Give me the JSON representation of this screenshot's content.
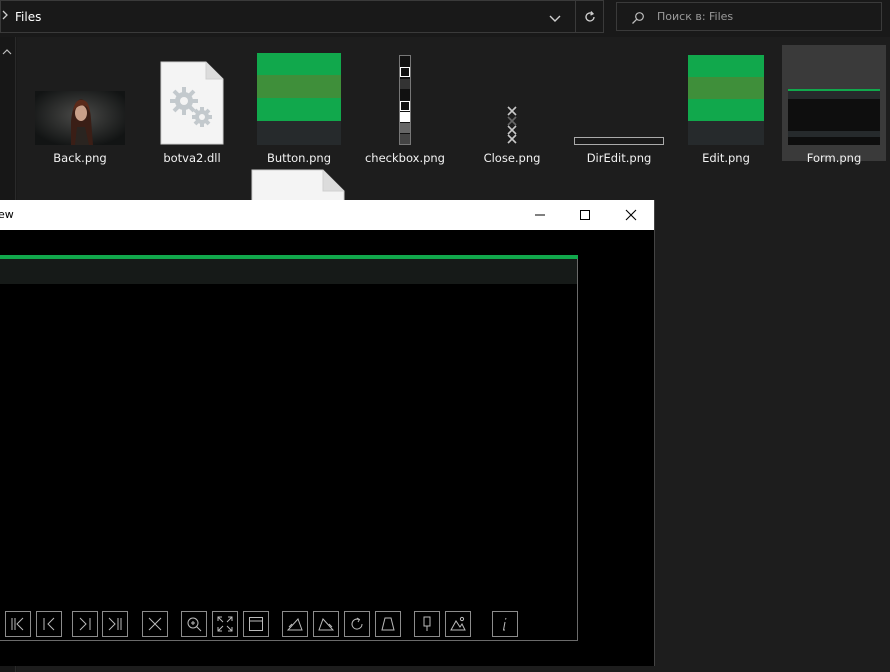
{
  "explorer": {
    "breadcrumb": "Files",
    "search_placeholder": "Поиск в: Files"
  },
  "files": [
    {
      "name": "Back.png"
    },
    {
      "name": "botva2.dll"
    },
    {
      "name": "Button.png"
    },
    {
      "name": "checkbox.png"
    },
    {
      "name": "Close.png"
    },
    {
      "name": "DirEdit.png"
    },
    {
      "name": "Edit.png"
    },
    {
      "name": "Form.png"
    }
  ],
  "preview": {
    "title": "ew"
  },
  "colors": {
    "accent_green": "#11a84c",
    "bg_dark": "#191919",
    "selected": "#3a3a3a"
  }
}
